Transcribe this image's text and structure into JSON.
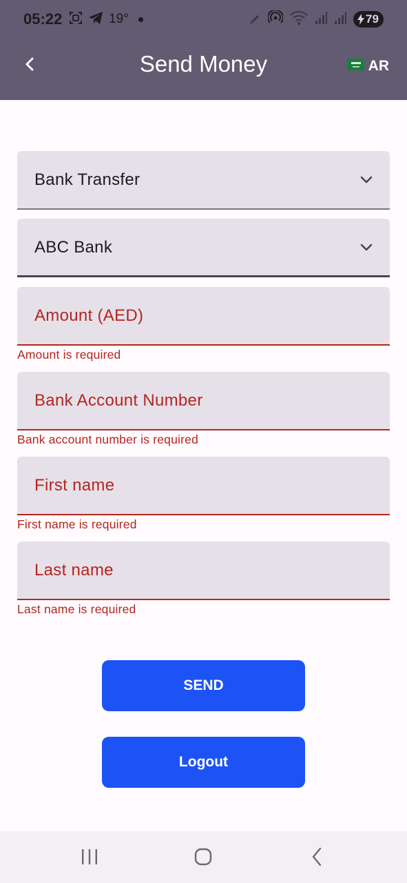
{
  "status_bar": {
    "time": "05:22",
    "temperature": "19°",
    "battery": "79",
    "icons_left": [
      "screenshot-icon",
      "telegram-icon"
    ],
    "icons_right": [
      "pen-icon",
      "hotspot-icon",
      "wifi-icon",
      "signal-icon",
      "signal-icon",
      "battery-icon"
    ]
  },
  "app_bar": {
    "title": "Send Money",
    "back_icon": "chevron-left-icon",
    "language": {
      "flag": "saudi-flag-icon",
      "label": "AR"
    }
  },
  "form": {
    "transfer_type": {
      "value": "Bank Transfer",
      "icon": "chevron-down-icon"
    },
    "bank": {
      "value": "ABC Bank",
      "icon": "chevron-down-icon"
    },
    "amount": {
      "placeholder": "Amount (AED)",
      "error": "Amount is required",
      "value": ""
    },
    "account_number": {
      "placeholder": "Bank Account Number",
      "error": "Bank account number is required",
      "value": ""
    },
    "first_name": {
      "placeholder": "First name",
      "error": "First name is required",
      "value": ""
    },
    "last_name": {
      "placeholder": "Last name",
      "error": "Last name is required",
      "value": ""
    }
  },
  "actions": {
    "send_label": "SEND",
    "logout_label": "Logout"
  },
  "colors": {
    "appbar": "#625b71",
    "field_bg": "#e6e0e9",
    "error": "#b3261e",
    "button": "#1d53f5"
  },
  "nav_bar": [
    "recent-apps-icon",
    "home-icon",
    "back-icon"
  ]
}
